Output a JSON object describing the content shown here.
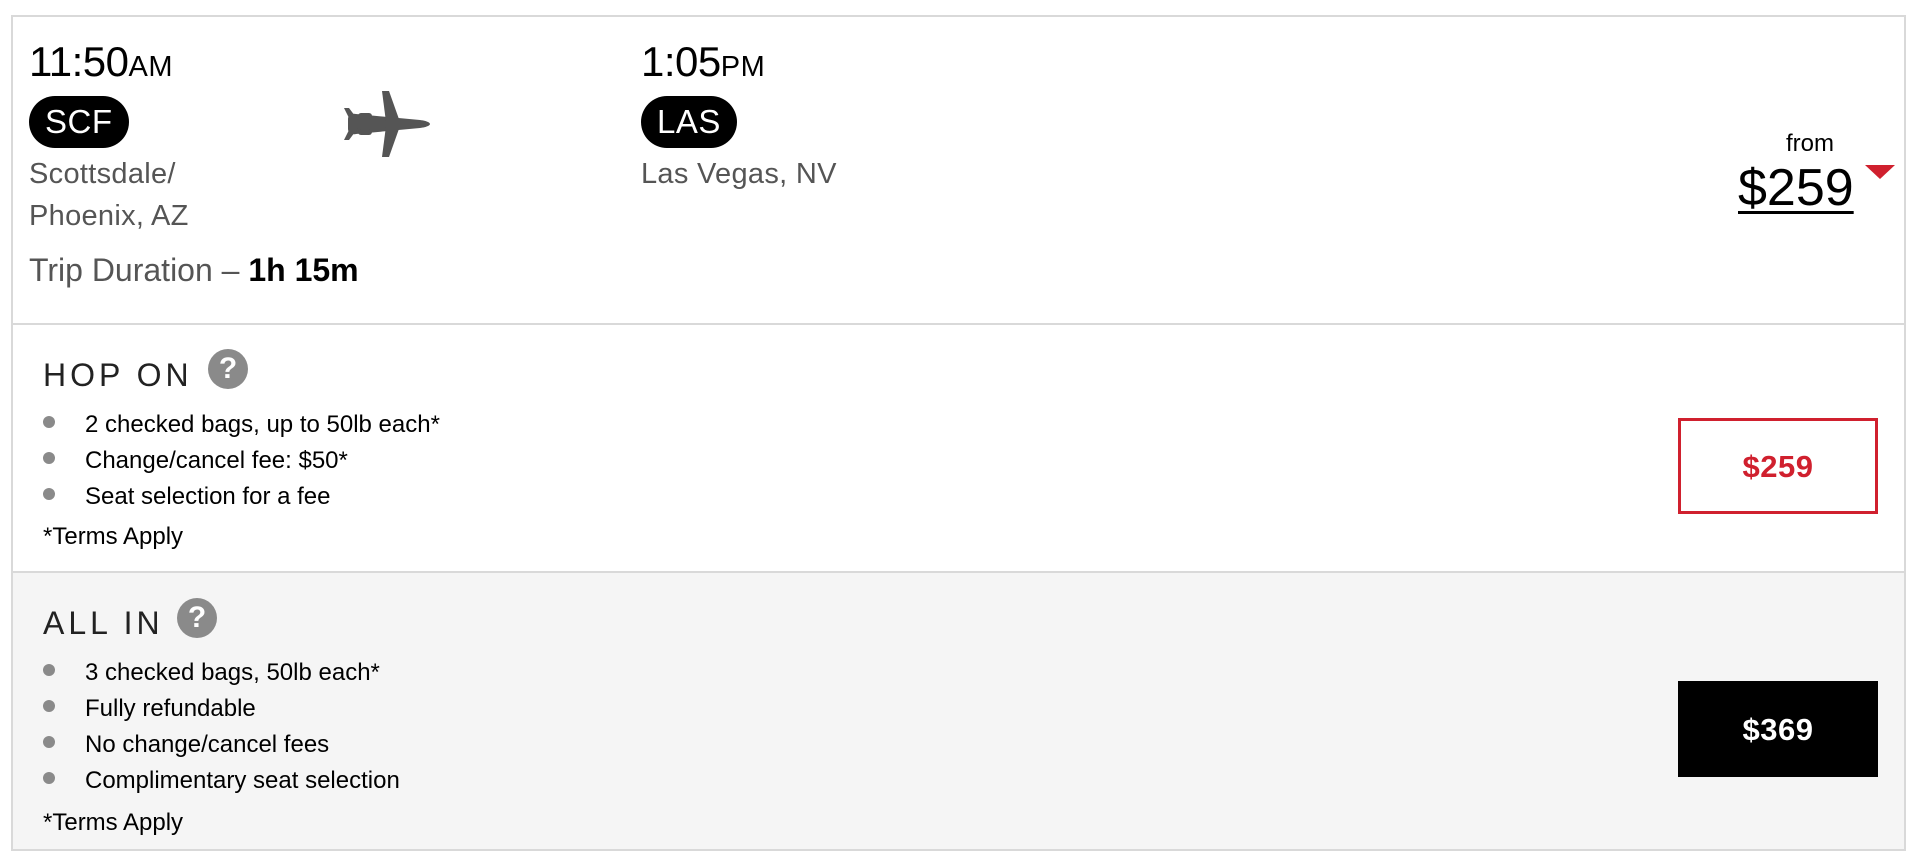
{
  "flight": {
    "departure": {
      "time": "11:50",
      "ampm": "AM",
      "code": "SCF",
      "city_line1": "Scottsdale/",
      "city_line2": "Phoenix, AZ"
    },
    "arrival": {
      "time": "1:05",
      "ampm": "PM",
      "code": "LAS",
      "city": "Las Vegas, NV"
    },
    "duration_label": "Trip Duration – ",
    "duration_value": "1h 15m",
    "plane_icon": "airplane-icon",
    "from_label": "from",
    "from_price": "$259",
    "caret_icon": "caret-down-icon"
  },
  "fares": {
    "hop_on": {
      "title": "HOP ON",
      "help_icon": "?",
      "features": [
        "2 checked bags, up to 50lb each*",
        "Change/cancel fee: $50*",
        "Seat selection for a fee"
      ],
      "terms": "*Terms Apply",
      "price": "$259"
    },
    "all_in": {
      "title": "ALL IN",
      "help_icon": "?",
      "features": [
        "3 checked bags, 50lb each*",
        "Fully refundable",
        "No change/cancel fees",
        "Complimentary seat selection"
      ],
      "terms": "*Terms Apply",
      "price": "$369"
    }
  },
  "colors": {
    "accent_red": "#d0202e",
    "pill_black": "#000000",
    "muted_text": "#555555",
    "icon_gray": "#8a8a8a",
    "alt_row_bg": "#f5f5f5"
  }
}
